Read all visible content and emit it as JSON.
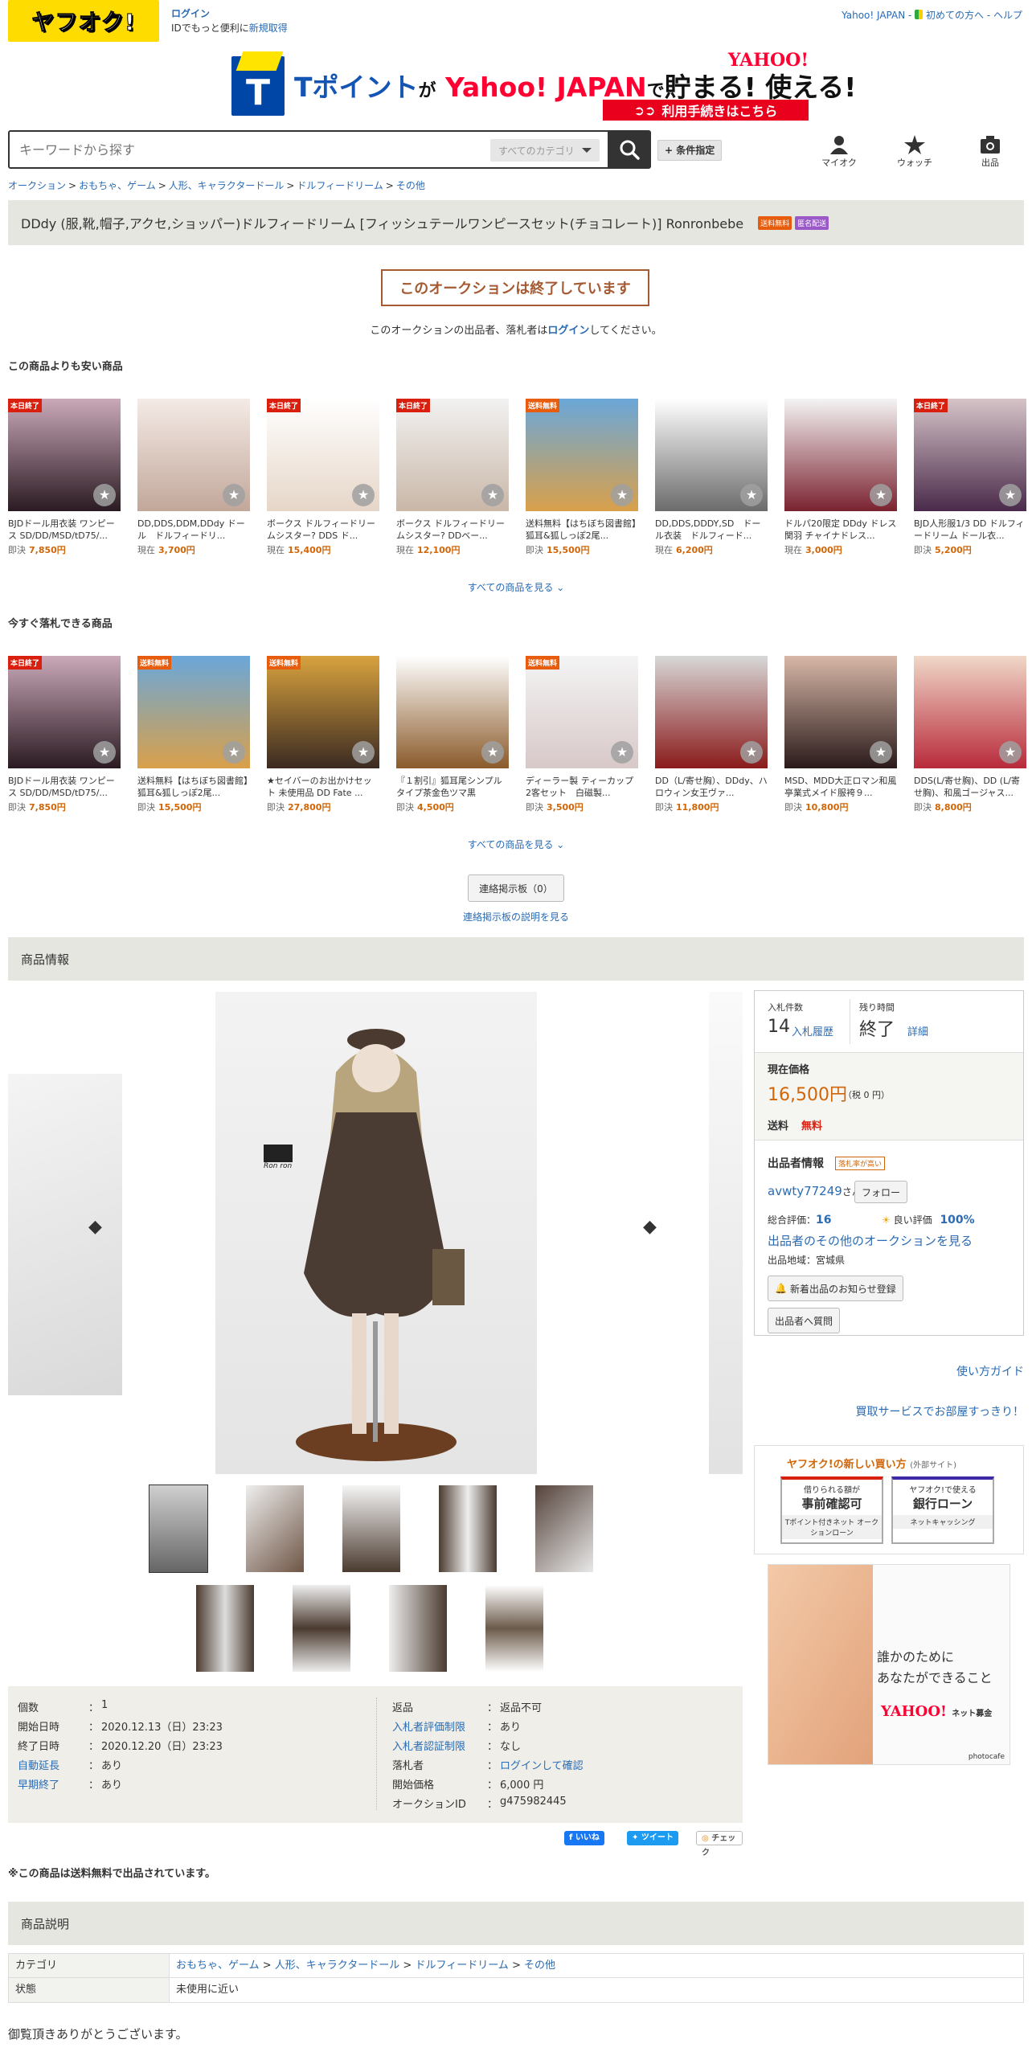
{
  "header": {
    "logo_text": "ヤフオク!",
    "login_label": "ログイン",
    "id_text": "IDでもっと便利に",
    "new_id_link": "新規取得",
    "top_links": [
      "Yahoo! JAPAN",
      "初めての方へ",
      "ヘルプ"
    ]
  },
  "banner": {
    "t_letter": "T",
    "text_pre": "Tポイント",
    "text_ga": "が",
    "text_yahoo": "Yahoo! JAPAN",
    "text_de": "で",
    "text_end": "貯まる! 使える!",
    "yahoo_logo": "YAHOO!",
    "cta": "利用手続きはこちら"
  },
  "search": {
    "placeholder": "キーワードから探す",
    "category": "すべてのカテゴリ",
    "condition_button": "+ 条件指定"
  },
  "header_icons": {
    "myauc": "マイオク",
    "watch": "ウォッチ",
    "sell": "出品"
  },
  "breadcrumb": [
    "オークション",
    "おもちゃ、ゲーム",
    "人形、キャラクタードール",
    "ドルフィードリーム",
    "その他"
  ],
  "title": {
    "text": "DDdy (服,靴,帽子,アクセ,ショッパー)ドルフィードリーム [フィッシュテールワンピースセット(チョコレート)] Ronronbebe",
    "badge1": "送料無料",
    "badge2": "匿名配送"
  },
  "ended": {
    "message": "このオークションは終了しています",
    "note_pre": "このオークションの出品者、落札者は",
    "note_link": "ログイン",
    "note_post": "してください。"
  },
  "cheaper": {
    "heading": "この商品よりも安い商品",
    "see_all": "すべての商品を見る",
    "items": [
      {
        "ribbon": "本日終了",
        "name": "BJDドール用衣装 ワンピース SD/DD/MSD/tD75/...",
        "label": "即決",
        "price": "7,850円"
      },
      {
        "ribbon": "",
        "name": "DD,DDS,DDM,DDdy ドール　ドルフィードリ...",
        "label": "現在",
        "price": "3,700円"
      },
      {
        "ribbon": "本日終了",
        "name": "ボークス ドルフィードリームシスター? DDS ド...",
        "label": "現在",
        "price": "15,400円"
      },
      {
        "ribbon": "本日終了",
        "name": "ボークス ドルフィードリームシスター? DDベー...",
        "label": "現在",
        "price": "12,100円"
      },
      {
        "ribbon": "送料無料",
        "name": "送料無料【はちぼち図書館】狐耳&狐しっぽ2尾...",
        "label": "即決",
        "price": "15,500円"
      },
      {
        "ribbon": "",
        "name": "DD,DDS,DDDY,SD　ドール衣装　ドルフィード...",
        "label": "現在",
        "price": "6,200円"
      },
      {
        "ribbon": "",
        "name": "ドルパ20限定 DDdy ドレス 関羽 チャイナドレス...",
        "label": "現在",
        "price": "3,000円"
      },
      {
        "ribbon": "本日終了",
        "name": "BJD人形服1/3 DD ドルフィードリーム ドール衣...",
        "label": "即決",
        "price": "5,200円"
      }
    ]
  },
  "buynow": {
    "heading": "今すぐ落札できる商品",
    "see_all": "すべての商品を見る",
    "items": [
      {
        "ribbon": "本日終了",
        "name": "BJDドール用衣装 ワンピース SD/DD/MSD/tD75/...",
        "label": "即決",
        "price": "7,850円"
      },
      {
        "ribbon": "送料無料",
        "name": "送料無料【はちぼち図書館】狐耳&狐しっぽ2尾...",
        "label": "即決",
        "price": "15,500円"
      },
      {
        "ribbon": "送料無料",
        "name": "★セイバーのお出かけセット 未使用品 DD Fate ...",
        "label": "即決",
        "price": "27,800円"
      },
      {
        "ribbon": "",
        "name": "『１割引』狐耳尾シンプルタイプ茶金色ツマ黒",
        "label": "即決",
        "price": "4,500円"
      },
      {
        "ribbon": "送料無料",
        "name": "ディーラー製 ティーカップ2客セット　白磁製...",
        "label": "即決",
        "price": "3,500円"
      },
      {
        "ribbon": "",
        "name": "DD（L/寄せ胸）、DDdy、ハロウィン女王ヴァ...",
        "label": "即決",
        "price": "11,800円"
      },
      {
        "ribbon": "",
        "name": "MSD、MDD大正ロマン和風亭業式メイド服袴９...",
        "label": "即決",
        "price": "10,800円"
      },
      {
        "ribbon": "",
        "name": "DDS(L/寄せ胸)、DD (L/寄せ胸)、和風ゴージャス...",
        "label": "即決",
        "price": "8,800円"
      }
    ]
  },
  "board": {
    "button": "連絡掲示板（0）",
    "link": "連絡掲示板の説明を見る"
  },
  "info_heading": "商品情報",
  "gallery": {
    "watermark": "Ron ron"
  },
  "bid": {
    "count_label": "入札件数",
    "count": "14",
    "history_link": "入札履歴",
    "time_label": "残り時間",
    "time_value": "終了",
    "detail_link": "詳細",
    "price_label": "現在価格",
    "price": "16,500円",
    "tax": "（税 0 円）",
    "shipping_label": "送料",
    "shipping_value": "無料",
    "seller_heading": "出品者情報",
    "seller_badge": "落札率が高い",
    "seller_name": "avwty77249",
    "seller_suffix": "さん",
    "follow": "フォロー",
    "rating_label": "総合評価：",
    "rating": "16",
    "good_label": "良い評価",
    "good_pct": "100%",
    "other_auctions": "出品者のその他のオークションを見る",
    "region": "出品地域：宮城県",
    "notify_button": "新着出品のお知らせ登録",
    "question_button": "出品者へ質問"
  },
  "side_links": {
    "guide": "使い方ガイド",
    "buyback": "買取サービスでお部屋すっきり！"
  },
  "newbuy": {
    "title": "ヤフオク!の新しい買い方",
    "title_sub": "(外部サイト)",
    "card1_sub": "借りられる額が",
    "card1_main": "事前確認可",
    "card1_foot": "Tポイント付きネット オークションローン",
    "card2_sub": "ヤフオク!で使える",
    "card2_main": "銀行ローン",
    "card2_foot": "ネットキャッシング"
  },
  "ad": {
    "line1": "誰かのために",
    "line2": "あなたができること",
    "brand": "YAHOO!",
    "brand_sub": "ネット募金",
    "credit": "photocafe"
  },
  "details": {
    "left": [
      {
        "k": "個数",
        "v": "1",
        "link": false
      },
      {
        "k": "開始日時",
        "v": "2020.12.13（日）23:23",
        "link": false
      },
      {
        "k": "終了日時",
        "v": "2020.12.20（日）23:23",
        "link": false
      },
      {
        "k": "自動延長",
        "v": "あり",
        "link": true
      },
      {
        "k": "早期終了",
        "v": "あり",
        "link": true
      }
    ],
    "right": [
      {
        "k": "返品",
        "v": "返品不可",
        "link": false,
        "vlink": false
      },
      {
        "k": "入札者評価制限",
        "v": "あり",
        "link": true,
        "vlink": false
      },
      {
        "k": "入札者認証制限",
        "v": "なし",
        "link": true,
        "vlink": false
      },
      {
        "k": "落札者",
        "v": "ログインして確認",
        "link": false,
        "vlink": true
      },
      {
        "k": "開始価格",
        "v": "6,000 円",
        "link": false,
        "vlink": false
      },
      {
        "k": "オークションID",
        "v": "g475982445",
        "link": false,
        "vlink": false
      }
    ]
  },
  "social": {
    "like": "いいね",
    "tweet": "ツイート",
    "check": "チェック"
  },
  "free_note": "※この商品は送料無料で出品されています。",
  "desc_heading": "商品説明",
  "category_table": {
    "cat_label": "カテゴリ",
    "cat_path": [
      "おもちゃ、ゲーム",
      "人形、キャラクタードール",
      "ドルフィードリーム",
      "その他"
    ],
    "state_label": "状態",
    "state_value": "未使用に近い"
  },
  "thanks": "御覧頂きありがとうございます。",
  "colors": {
    "accent_orange": "#d16608",
    "link_blue": "#2a6bb3",
    "ended_brown": "#a45b33",
    "ribbon_red": "#d9200f",
    "band_gray": "#e6e6e0"
  }
}
